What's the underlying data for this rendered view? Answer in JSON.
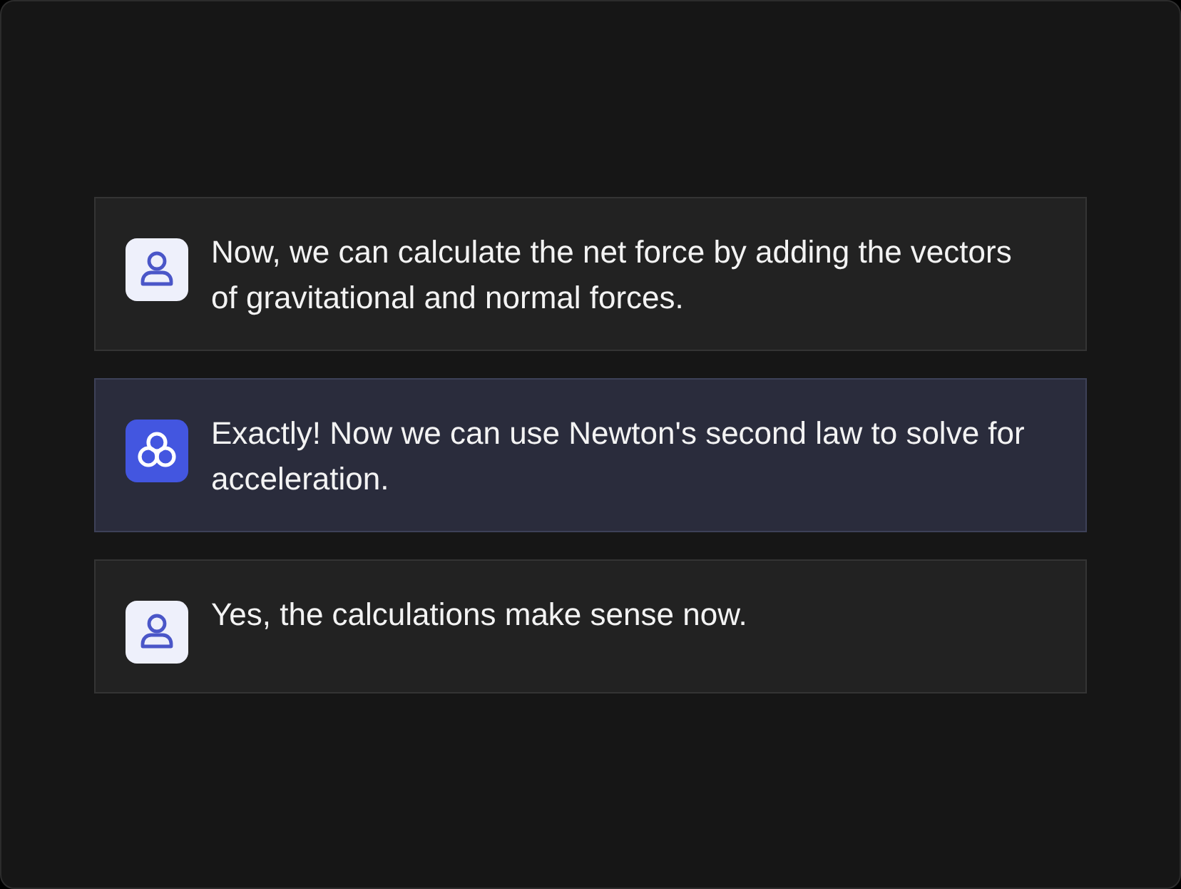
{
  "messages": [
    {
      "kind": "user",
      "text": "Now, we can calculate the net force by adding the vectors of gravitational and normal forces."
    },
    {
      "kind": "assistant",
      "text": "Exactly! Now we can use Newton's second law to solve for acceleration."
    },
    {
      "kind": "user",
      "text": "Yes, the calculations make sense now."
    }
  ]
}
